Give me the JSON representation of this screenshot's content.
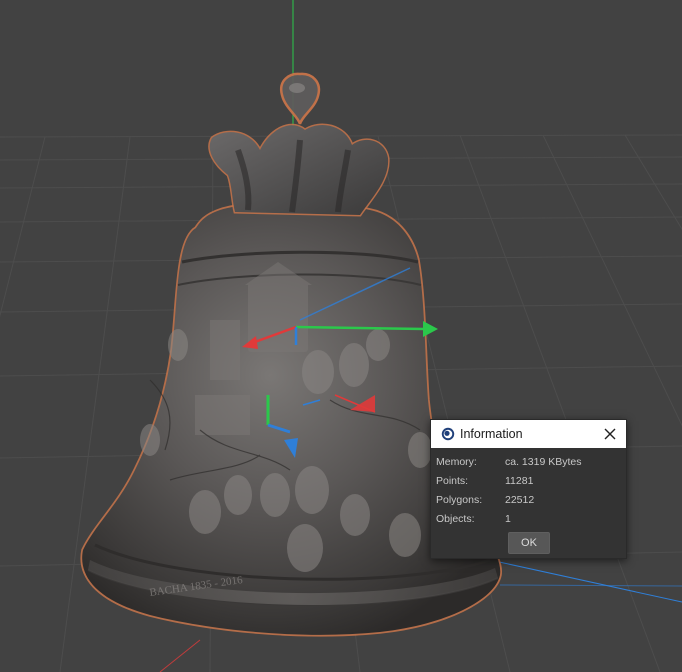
{
  "colors": {
    "viewport_bg": "#424242",
    "grid_line": "#4c4c4c",
    "axis_green": "#2bc84b",
    "axis_red": "#e03a3a",
    "axis_blue": "#2f7fd8",
    "bell_outline": "#c8744a",
    "dialog_bg": "#333333",
    "titlebar_bg": "#ffffff"
  },
  "scene": {
    "model_name": "bell-model"
  },
  "dialog": {
    "title": "Information",
    "icon": "cinema4d-app-icon",
    "close_icon": "close-icon",
    "rows": [
      {
        "label": "Memory:",
        "value": "ca. 1319 KBytes"
      },
      {
        "label": "Points:",
        "value": "11281"
      },
      {
        "label": "Polygons:",
        "value": "22512"
      },
      {
        "label": "Objects:",
        "value": "1"
      }
    ],
    "ok_label": "OK"
  }
}
